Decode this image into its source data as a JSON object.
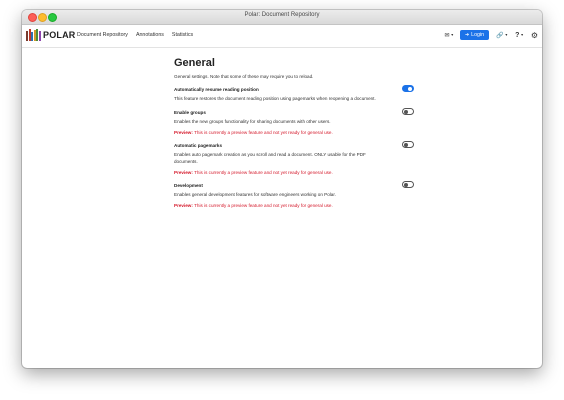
{
  "window": {
    "title": "Polar: Document Repository"
  },
  "navbar": {
    "brand": "POLAR",
    "links": [
      "Document Repository",
      "Annotations",
      "Statistics"
    ],
    "login_label": "Login"
  },
  "page": {
    "title": "General",
    "intro": "General settings. Note that some of these may require you to reload."
  },
  "settings": [
    {
      "title": "Automatically resume reading position",
      "description": "This feature restores the document reading position using pagemarks when reopening a document.",
      "enabled": true
    },
    {
      "title": "Enable groups",
      "description": "Enables the new groups functionality for sharing documents with other users.",
      "preview_prefix": "Preview:",
      "preview_text": " This is currently a preview feature and not yet ready for general use.",
      "enabled": false
    },
    {
      "title": "Automatic pagemarks",
      "description": "Enables auto pagemark creation as you scroll and read a document. ONLY usable for the PDF documents.",
      "preview_prefix": "Preview:",
      "preview_text": " This is currently a preview feature and not yet ready for general use.",
      "enabled": false
    },
    {
      "title": "Development",
      "description": "Enables general development features for software engineers working on Polar.",
      "preview_prefix": "Preview:",
      "preview_text": " This is currently a preview feature and not yet ready for general use.",
      "enabled": false
    }
  ],
  "colors": {
    "accent": "#1b72e8",
    "preview": "#d4182a"
  },
  "icons": [
    "envelope-icon",
    "sign-in-icon",
    "link-icon",
    "help-icon",
    "gear-icon"
  ]
}
